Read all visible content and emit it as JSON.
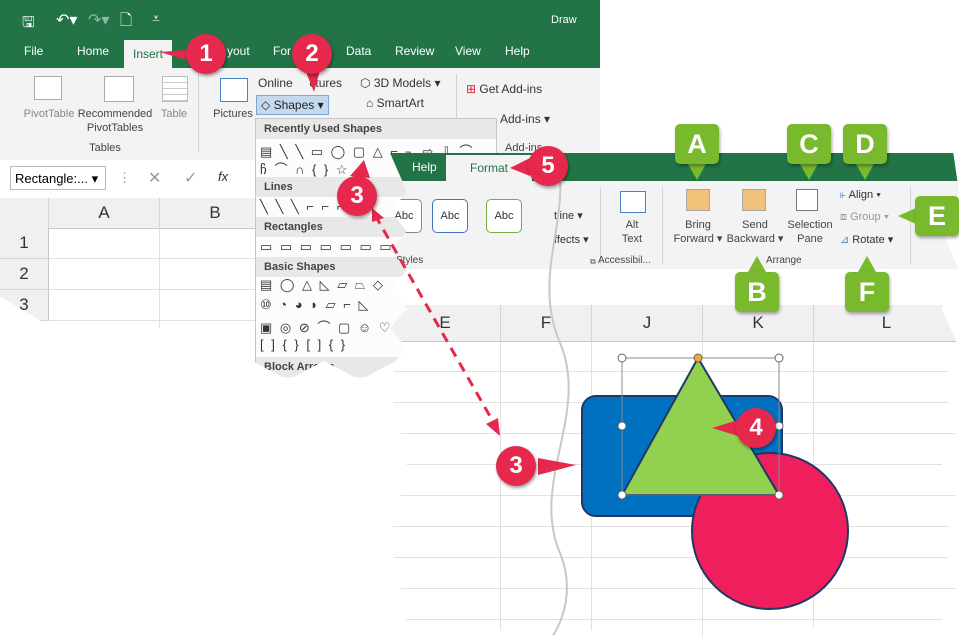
{
  "left": {
    "window_title": "Draw",
    "tabs": [
      "File",
      "Home",
      "Insert",
      "yout",
      "For",
      "Data",
      "Review",
      "View",
      "Help"
    ],
    "ribbon": {
      "pivottable": "PivotTable",
      "recommended": "Recommended",
      "pivottables": "PivotTables",
      "table": "Table",
      "group_tables": "Tables",
      "pictures": "Pictures",
      "online_pictures": "Online",
      "online_pictures_rest": "ctures",
      "shapes": "Shapes",
      "models_3d": "3D Models",
      "smartart": "SmartArt",
      "get_addins": "Get Add-ins",
      "my_addins": "Add-ins",
      "group_addins": "Add-ins"
    },
    "name_box": "Rectangle:...",
    "fx": "fx",
    "columns": [
      "A",
      "B"
    ],
    "rows": [
      "1",
      "2",
      "3"
    ],
    "dropdown": {
      "recently_used": "Recently Used Shapes",
      "lines": "Lines",
      "rectangles": "Rectangles",
      "basic_shapes": "Basic Shapes",
      "block_arrows": "Block Arrows",
      "recent_glyphs": "▤ ╲ ╲ ▭ ◯ ▢ △ ⌐ ┐ ⇨ ⇩ ⌒",
      "recent_glyphs2": "ჩ ⌒ ∩ { } ☆",
      "line_glyphs": "╲ ╲ ╲ ⌐ ⌐ ⌐ ╲",
      "rect_glyphs": "▭ ▭ ▭ ▭ ▭ ▭ ▭ ▭",
      "basic_glyphs1": "▤ ◯ △ ◺ ▱ ⏢ ◇",
      "basic_glyphs2": "⑩ ◔ ◕ ◗ ▱ ⌐ ◺",
      "basic_glyphs3": "▣ ◎ ⊘ ⌒ ▢ ☺ ♡",
      "basic_glyphs4": "[ ] { } [ ] { }"
    }
  },
  "right": {
    "tabs": {
      "help": "Help",
      "format": "Format"
    },
    "styles_label": "Styles",
    "abc": [
      "Abc",
      "Abc",
      "Abc"
    ],
    "outline": "tline",
    "effects": "ffects",
    "alt_text": [
      "Alt",
      "Text"
    ],
    "accessibility": "Accessibil...",
    "bring_forward": [
      "Bring",
      "Forward"
    ],
    "send_backward": [
      "Send",
      "Backward"
    ],
    "selection_pane": [
      "Selection",
      "Pane"
    ],
    "align": "Align",
    "group": "Group",
    "rotate": "Rotate",
    "arrange": "Arrange",
    "columns": [
      "E",
      "F",
      "J",
      "K",
      "L"
    ]
  },
  "callouts": {
    "step1": "1",
    "step2": "2",
    "step3a": "3",
    "step3b": "3",
    "step4": "4",
    "step5": "5",
    "A": "A",
    "B": "B",
    "C": "C",
    "D": "D",
    "E": "E",
    "F": "F"
  },
  "colors": {
    "excel_green": "#227447",
    "callout_red": "#e5284b",
    "callout_green": "#78b92d",
    "shape_blue": "#0070c0",
    "shape_green": "#92d050",
    "shape_pink": "#ee1f5c"
  }
}
